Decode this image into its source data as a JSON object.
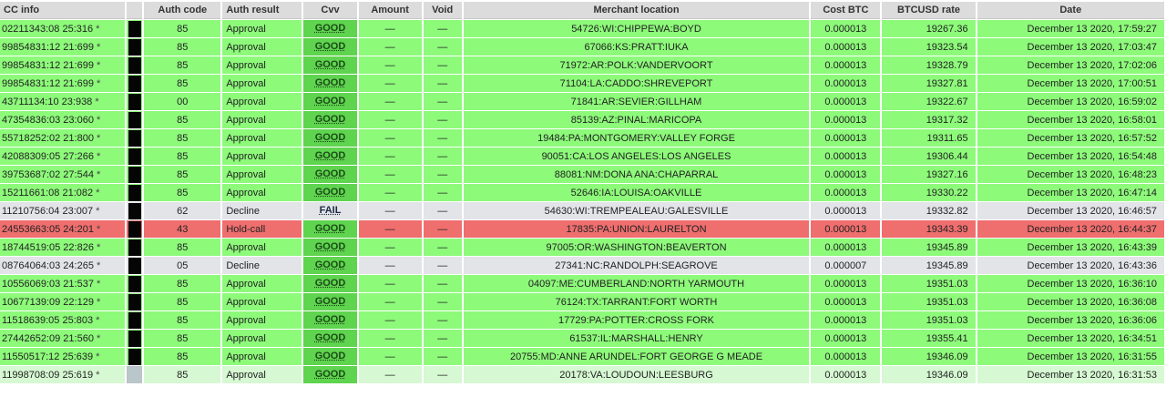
{
  "columns": {
    "cc_info": "CC info",
    "auth_code": "Auth code",
    "auth_result": "Auth result",
    "cvv": "Cvv",
    "amount": "Amount",
    "void": "Void",
    "merchant_location": "Merchant location",
    "cost_btc": "Cost BTC",
    "btcusd_rate": "BTCUSD rate",
    "date": "Date"
  },
  "colors": {
    "approved_row": "#8dfa7a",
    "declined_row": "#e2e4e8",
    "hold_row": "#ef6e6e",
    "cvv_good": "#5fd44f"
  },
  "rows": [
    {
      "status": "green",
      "cc_info": "02211343:08 25:316",
      "star": "*",
      "auth_code": "85",
      "auth_result": "Approval",
      "cvv": "GOOD",
      "amount": "—",
      "void": "—",
      "merchant": "54726:WI:CHIPPEWA:BOYD",
      "cost_btc": "0.000013",
      "btcusd": "19267.36",
      "date": "December 13 2020, 17:59:27"
    },
    {
      "status": "green",
      "cc_info": "99854831:12 21:699",
      "star": "*",
      "auth_code": "85",
      "auth_result": "Approval",
      "cvv": "GOOD",
      "amount": "—",
      "void": "—",
      "merchant": "67066:KS:PRATT:IUKA",
      "cost_btc": "0.000013",
      "btcusd": "19323.54",
      "date": "December 13 2020, 17:03:47"
    },
    {
      "status": "green",
      "cc_info": "99854831:12 21:699",
      "star": "*",
      "auth_code": "85",
      "auth_result": "Approval",
      "cvv": "GOOD",
      "amount": "—",
      "void": "—",
      "merchant": "71972:AR:POLK:VANDERVOORT",
      "cost_btc": "0.000013",
      "btcusd": "19328.79",
      "date": "December 13 2020, 17:02:06"
    },
    {
      "status": "green",
      "cc_info": "99854831:12 21:699",
      "star": "*",
      "auth_code": "85",
      "auth_result": "Approval",
      "cvv": "GOOD",
      "amount": "—",
      "void": "—",
      "merchant": "71104:LA:CADDO:SHREVEPORT",
      "cost_btc": "0.000013",
      "btcusd": "19327.81",
      "date": "December 13 2020, 17:00:51"
    },
    {
      "status": "green",
      "cc_info": "43711134:10 23:938",
      "star": "*",
      "auth_code": "00",
      "auth_result": "Approval",
      "cvv": "GOOD",
      "amount": "—",
      "void": "—",
      "merchant": "71841:AR:SEVIER:GILLHAM",
      "cost_btc": "0.000013",
      "btcusd": "19322.67",
      "date": "December 13 2020, 16:59:02"
    },
    {
      "status": "green",
      "cc_info": "47354836:03 23:060",
      "star": "*",
      "auth_code": "85",
      "auth_result": "Approval",
      "cvv": "GOOD",
      "amount": "—",
      "void": "—",
      "merchant": "85139:AZ:PINAL:MARICOPA",
      "cost_btc": "0.000013",
      "btcusd": "19317.32",
      "date": "December 13 2020, 16:58:01"
    },
    {
      "status": "green",
      "cc_info": "55718252:02 21:800",
      "star": "*",
      "auth_code": "85",
      "auth_result": "Approval",
      "cvv": "GOOD",
      "amount": "—",
      "void": "—",
      "merchant": "19484:PA:MONTGOMERY:VALLEY FORGE",
      "cost_btc": "0.000013",
      "btcusd": "19311.65",
      "date": "December 13 2020, 16:57:52"
    },
    {
      "status": "green",
      "cc_info": "42088309:05 27:266",
      "star": "*",
      "auth_code": "85",
      "auth_result": "Approval",
      "cvv": "GOOD",
      "amount": "—",
      "void": "—",
      "merchant": "90051:CA:LOS ANGELES:LOS ANGELES",
      "cost_btc": "0.000013",
      "btcusd": "19306.44",
      "date": "December 13 2020, 16:54:48"
    },
    {
      "status": "green",
      "cc_info": "39753687:02 27:544",
      "star": "*",
      "auth_code": "85",
      "auth_result": "Approval",
      "cvv": "GOOD",
      "amount": "—",
      "void": "—",
      "merchant": "88081:NM:DONA ANA:CHAPARRAL",
      "cost_btc": "0.000013",
      "btcusd": "19327.16",
      "date": "December 13 2020, 16:48:23"
    },
    {
      "status": "green",
      "cc_info": "15211661:08 21:082",
      "star": "*",
      "auth_code": "85",
      "auth_result": "Approval",
      "cvv": "GOOD",
      "amount": "—",
      "void": "—",
      "merchant": "52646:IA:LOUISA:OAKVILLE",
      "cost_btc": "0.000013",
      "btcusd": "19330.22",
      "date": "December 13 2020, 16:47:14"
    },
    {
      "status": "grey",
      "cc_info": "11210756:04 23:007",
      "star": "*",
      "auth_code": "62",
      "auth_result": "Decline",
      "cvv": "FAIL",
      "amount": "—",
      "void": "—",
      "merchant": "54630:WI:TREMPEALEAU:GALESVILLE",
      "cost_btc": "0.000013",
      "btcusd": "19332.82",
      "date": "December 13 2020, 16:46:57"
    },
    {
      "status": "red",
      "cc_info": "24553663:05 24:201",
      "star": "*",
      "auth_code": "43",
      "auth_result": "Hold-call",
      "cvv": "GOOD",
      "amount": "—",
      "void": "—",
      "merchant": "17835:PA:UNION:LAURELTON",
      "cost_btc": "0.000013",
      "btcusd": "19343.39",
      "date": "December 13 2020, 16:44:37"
    },
    {
      "status": "green",
      "cc_info": "18744519:05 22:826",
      "star": "*",
      "auth_code": "85",
      "auth_result": "Approval",
      "cvv": "GOOD",
      "amount": "—",
      "void": "—",
      "merchant": "97005:OR:WASHINGTON:BEAVERTON",
      "cost_btc": "0.000013",
      "btcusd": "19345.89",
      "date": "December 13 2020, 16:43:39"
    },
    {
      "status": "grey",
      "cc_info": "08764064:03 24:265",
      "star": "*",
      "auth_code": "05",
      "auth_result": "Decline",
      "cvv": "GOOD",
      "amount": "—",
      "void": "—",
      "merchant": "27341:NC:RANDOLPH:SEAGROVE",
      "cost_btc": "0.000007",
      "btcusd": "19345.89",
      "date": "December 13 2020, 16:43:36"
    },
    {
      "status": "green",
      "cc_info": "10556069:03 21:537",
      "star": "*",
      "auth_code": "85",
      "auth_result": "Approval",
      "cvv": "GOOD",
      "amount": "—",
      "void": "—",
      "merchant": "04097:ME:CUMBERLAND:NORTH YARMOUTH",
      "cost_btc": "0.000013",
      "btcusd": "19351.03",
      "date": "December 13 2020, 16:36:10"
    },
    {
      "status": "green",
      "cc_info": "10677139:09 22:129",
      "star": "*",
      "auth_code": "85",
      "auth_result": "Approval",
      "cvv": "GOOD",
      "amount": "—",
      "void": "—",
      "merchant": "76124:TX:TARRANT:FORT WORTH",
      "cost_btc": "0.000013",
      "btcusd": "19351.03",
      "date": "December 13 2020, 16:36:08"
    },
    {
      "status": "green",
      "cc_info": "11518639:05 25:803",
      "star": "*",
      "auth_code": "85",
      "auth_result": "Approval",
      "cvv": "GOOD",
      "amount": "—",
      "void": "—",
      "merchant": "17729:PA:POTTER:CROSS FORK",
      "cost_btc": "0.000013",
      "btcusd": "19351.03",
      "date": "December 13 2020, 16:36:06"
    },
    {
      "status": "green",
      "cc_info": "27442652:09 21:560",
      "star": "*",
      "auth_code": "85",
      "auth_result": "Approval",
      "cvv": "GOOD",
      "amount": "—",
      "void": "—",
      "merchant": "61537:IL:MARSHALL:HENRY",
      "cost_btc": "0.000013",
      "btcusd": "19355.41",
      "date": "December 13 2020, 16:34:51"
    },
    {
      "status": "green",
      "cc_info": "11550517:12 25:639",
      "star": "*",
      "auth_code": "85",
      "auth_result": "Approval",
      "cvv": "GOOD",
      "amount": "—",
      "void": "—",
      "merchant": "20755:MD:ANNE ARUNDEL:FORT GEORGE G MEADE",
      "cost_btc": "0.000013",
      "btcusd": "19346.09",
      "date": "December 13 2020, 16:31:55"
    },
    {
      "status": "last",
      "cc_info": "11998708:09 25:619",
      "star": "*",
      "auth_code": "85",
      "auth_result": "Approval",
      "cvv": "GOOD",
      "amount": "—",
      "void": "—",
      "merchant": "20178:VA:LOUDOUN:LEESBURG",
      "cost_btc": "0.000013",
      "btcusd": "19346.09",
      "date": "December 13 2020, 16:31:53"
    }
  ]
}
